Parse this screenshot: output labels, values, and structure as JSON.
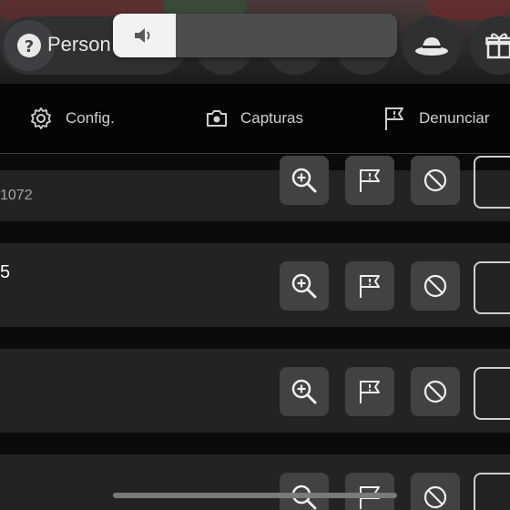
{
  "header": {
    "avatar_label": "Person",
    "icons": [
      "avatar-icon",
      "hat-icon",
      "gift-icon"
    ]
  },
  "volume": {
    "level": 0.22,
    "icon": "speaker-icon"
  },
  "menu": {
    "items": [
      {
        "label": "Config.",
        "icon": "gear-icon"
      },
      {
        "label": "Capturas",
        "icon": "camera-icon"
      },
      {
        "label": "Denunciar",
        "icon": "flag-icon"
      }
    ]
  },
  "players": [
    {
      "primary": "",
      "secondary": "1072"
    },
    {
      "primary": "5",
      "secondary": ""
    },
    {
      "primary": "",
      "secondary": ""
    },
    {
      "primary": "",
      "secondary": ""
    }
  ],
  "row_actions": [
    "inspect-zoom-icon",
    "report-flag-icon",
    "block-icon"
  ],
  "colors": {
    "row_bg": "#232325",
    "button_bg": "#424245",
    "accent_light": "#f2f2f2"
  }
}
